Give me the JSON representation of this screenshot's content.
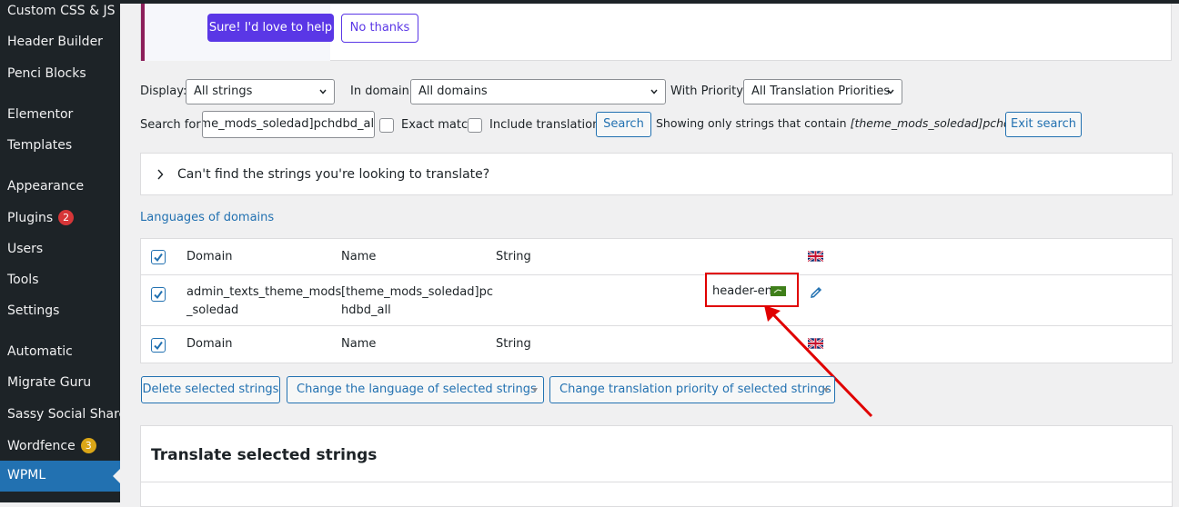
{
  "sidebar": {
    "items": [
      {
        "label": "Custom CSS & JS"
      },
      {
        "label": "Header Builder"
      },
      {
        "label": "Penci Blocks"
      },
      {
        "label": "Elementor"
      },
      {
        "label": "Templates"
      },
      {
        "label": "Appearance"
      },
      {
        "label": "Plugins",
        "badge": "2"
      },
      {
        "label": "Users"
      },
      {
        "label": "Tools"
      },
      {
        "label": "Settings"
      },
      {
        "label": "Automatic"
      },
      {
        "label": "Migrate Guru"
      },
      {
        "label": "Sassy Social Share"
      },
      {
        "label": "Wordfence",
        "badge": "3"
      },
      {
        "label": "WPML"
      }
    ],
    "plugins_badge_color": "#d63638",
    "wordfence_badge_color": "#dba617",
    "active_color": "#2271b1"
  },
  "notice": {
    "primary_label": "Sure! I'd love to help",
    "secondary_label": "No thanks",
    "accent_color": "#5a37e6"
  },
  "filters": {
    "display_label": "Display:",
    "display_value": "All strings",
    "domain_label": "In domain:",
    "domain_value": "All domains",
    "priority_label": "With Priority:",
    "priority_value": "All Translation Priorities",
    "search_label": "Search for:",
    "search_value": "[theme_mods_soledad]pchdbd_all",
    "exact_match_label": "Exact match",
    "include_translations_label": "Include translations",
    "search_button": "Search",
    "showing_prefix": "Showing only strings that contain",
    "showing_term": "[theme_mods_soledad]pchdbd_all",
    "exit_search_button": "Exit search"
  },
  "help_panel": {
    "title": "Can't find the strings you're looking to translate?"
  },
  "languages_link": "Languages of domains",
  "table": {
    "headers": {
      "domain": "Domain",
      "name": "Name",
      "string": "String"
    },
    "row": {
      "domain_line1": "admin_texts_theme_mods",
      "domain_line2": "_soledad",
      "name_line1": "[theme_mods_soledad]pc",
      "name_line2": "hdbd_all",
      "value": "header-en"
    },
    "flag_icon": "uk-flag-icon",
    "edit_icon": "pencil-icon",
    "highlight_color": "#e00000"
  },
  "actions": {
    "delete_label": "Delete selected strings",
    "change_language_label": "Change the language of selected strings",
    "change_priority_label": "Change translation priority of selected strings"
  },
  "translate_panel": {
    "title": "Translate selected strings"
  }
}
